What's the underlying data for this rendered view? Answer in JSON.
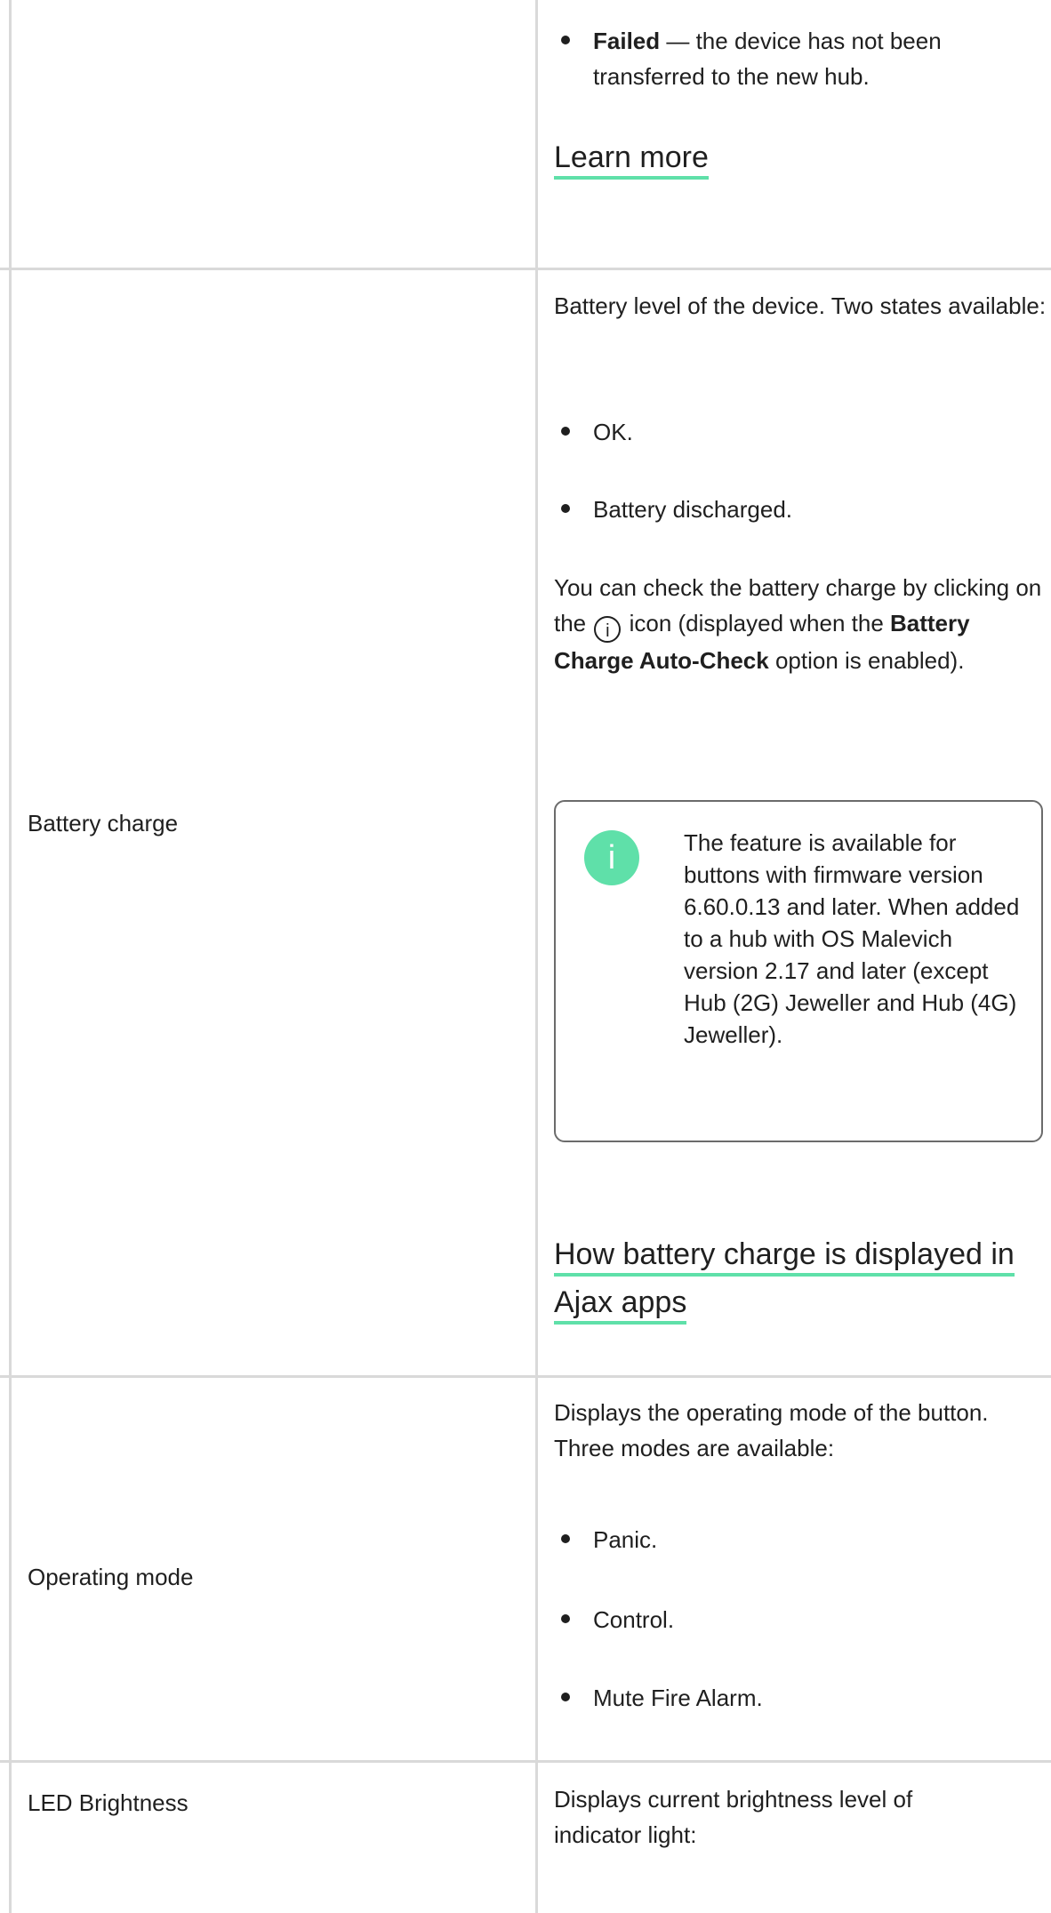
{
  "rows": {
    "migration": {
      "failed_bold": "Failed",
      "failed_rest": " — the device has not been transferred to the new hub.",
      "link": "Learn more"
    },
    "battery": {
      "label": "Battery charge",
      "intro": "Battery level of the device. Two states available:",
      "states": [
        "OK.",
        "Battery discharged."
      ],
      "check_before": "You can check the battery charge by clicking on the ",
      "check_icon_glyph": "i",
      "check_after": " icon (displayed when the ",
      "check_bold": "Battery Charge Auto-Check",
      "check_end": " option is enabled).",
      "note_icon": "i",
      "note": "The feature is available for buttons with firmware version 6.60.0.13 and later. When added to a hub with OS Malevich version 2.17 and later (except Hub (2G) Jeweller and Hub (4G) Jeweller).",
      "link": "How battery charge is displayed in Ajax apps"
    },
    "operating_mode": {
      "label": "Operating mode",
      "intro": "Displays the operating mode of the button. Three modes are available:",
      "modes": [
        "Panic.",
        "Control.",
        "Mute Fire Alarm."
      ]
    },
    "led": {
      "label": "LED Brightness",
      "intro": "Displays current brightness level of indicator light:"
    }
  },
  "colors": {
    "accent": "#5fe0a9",
    "border": "#d9d9d9",
    "text": "#1f1f1f"
  }
}
